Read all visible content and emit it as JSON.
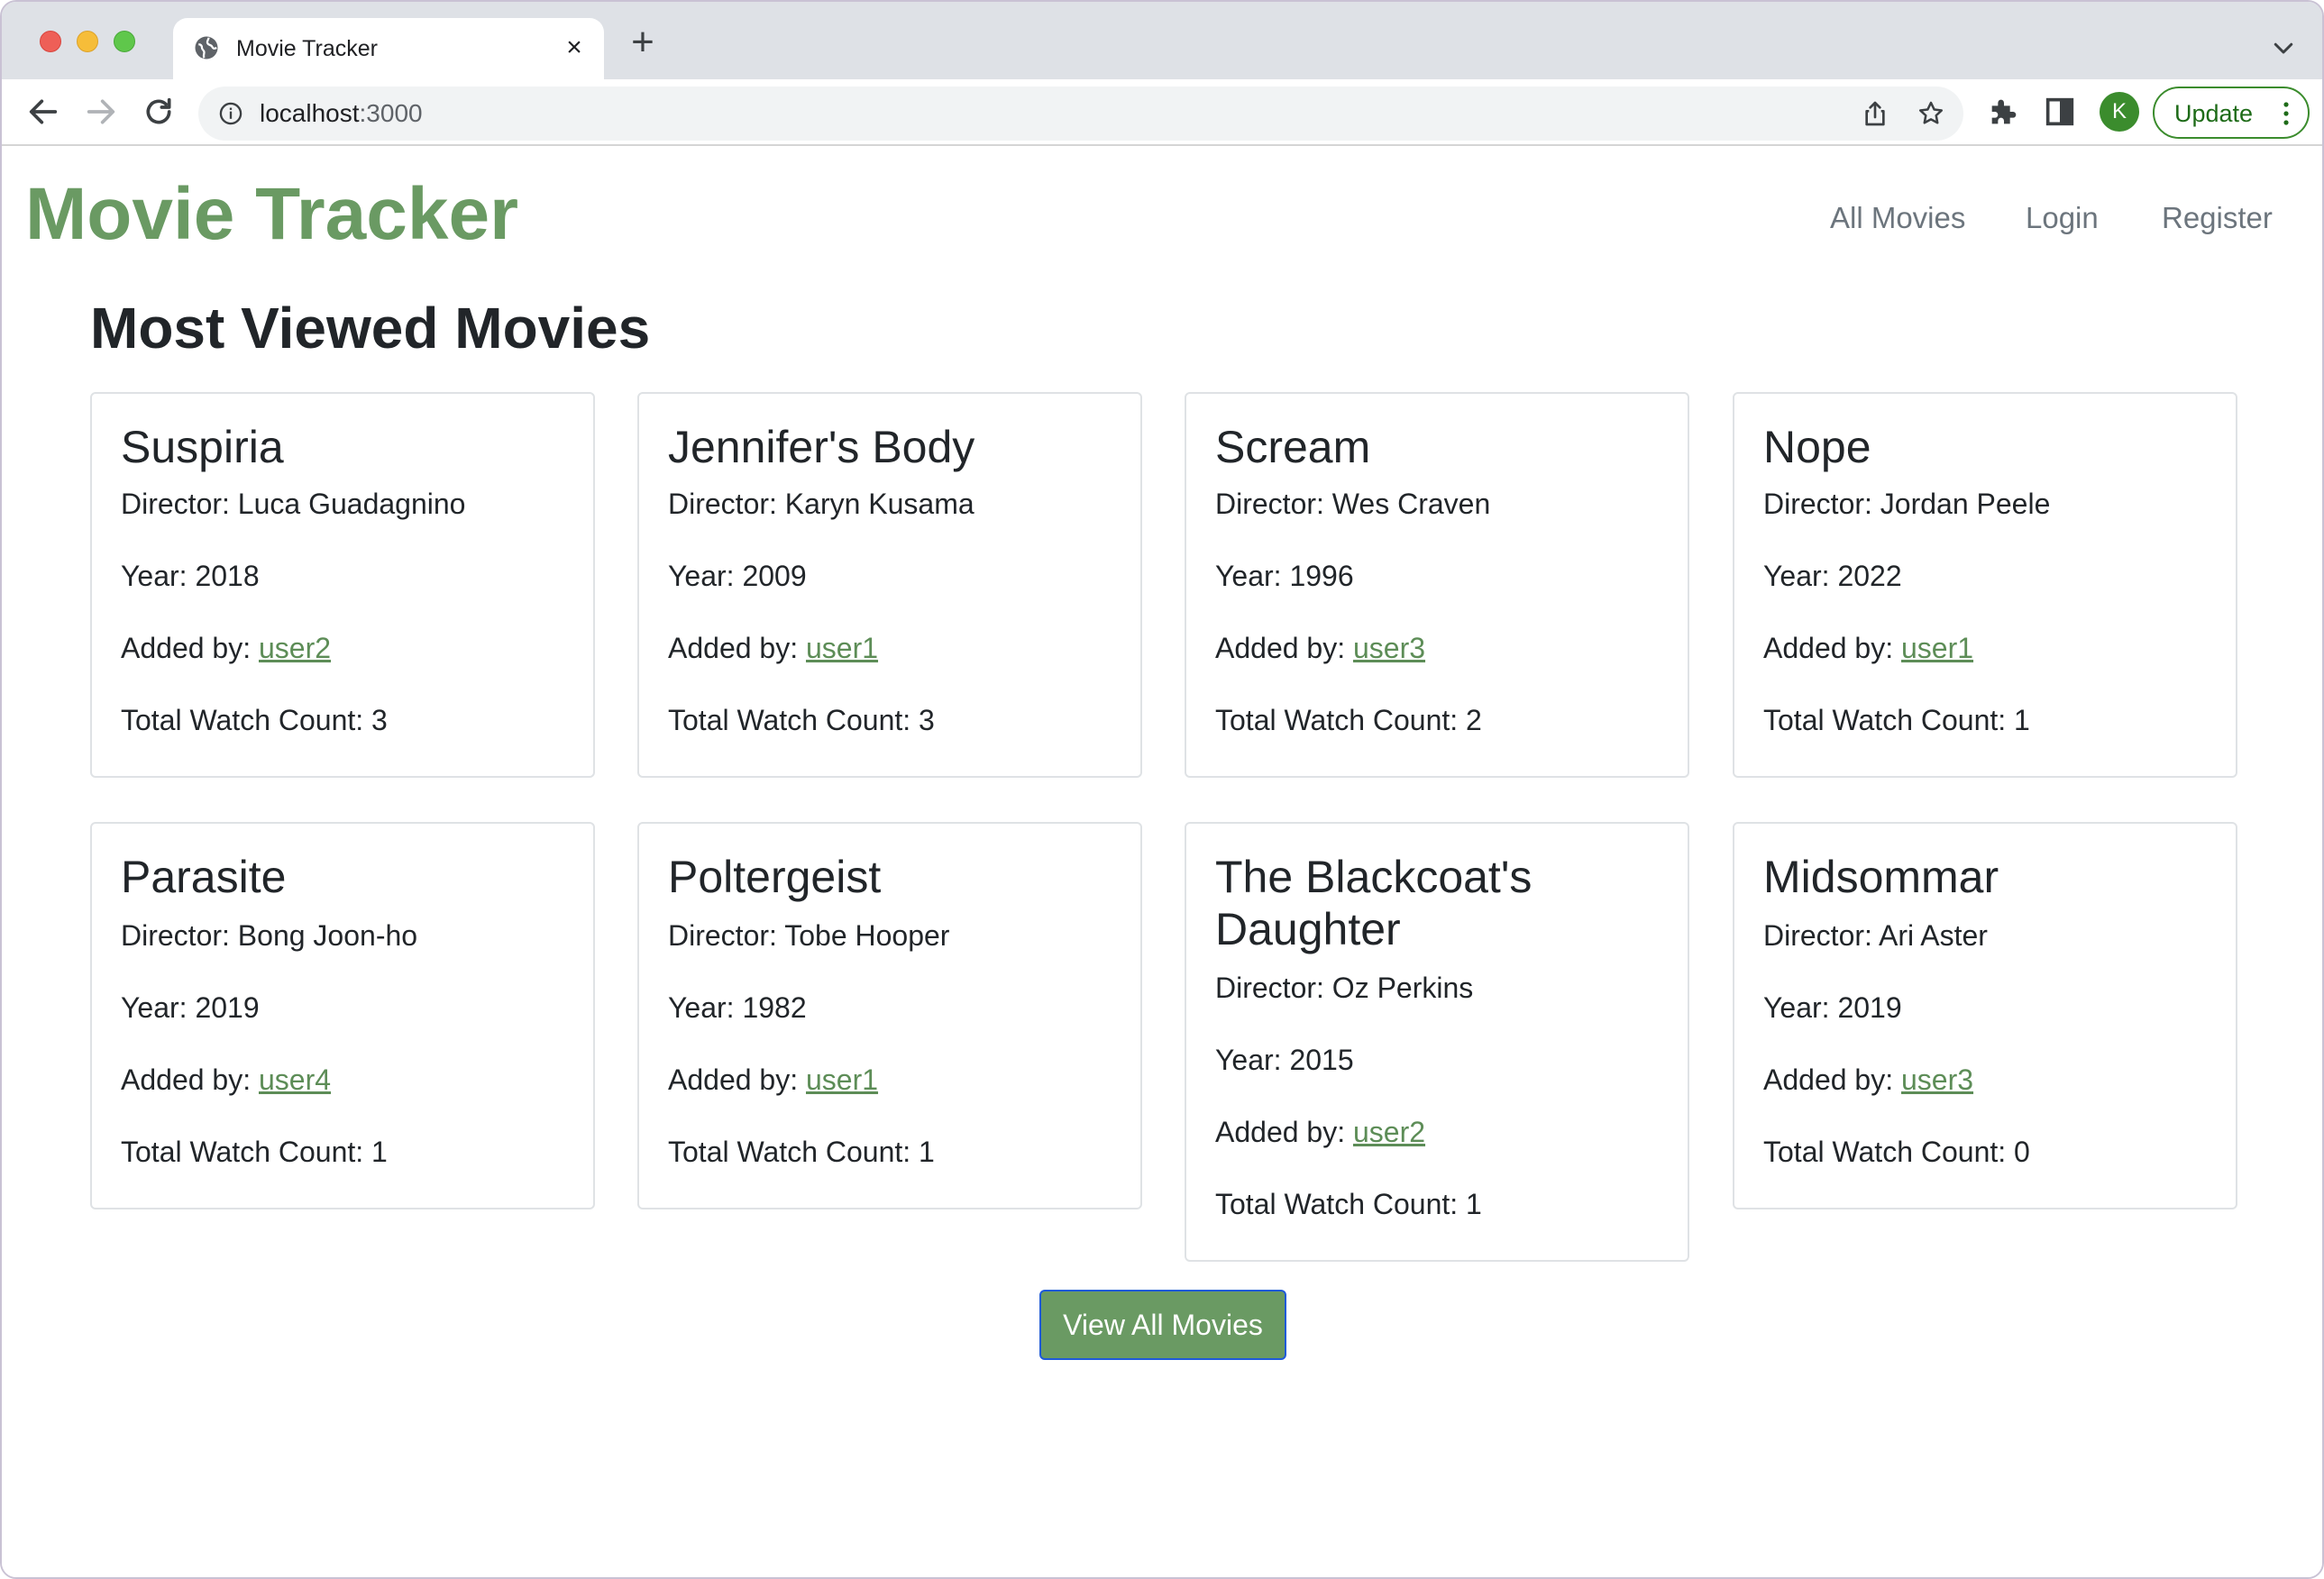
{
  "browser": {
    "tab_title": "Movie Tracker",
    "url_host": "localhost",
    "url_port": ":3000",
    "profile_initial": "K",
    "update_label": "Update"
  },
  "site": {
    "brand": "Movie Tracker",
    "nav": [
      "All Movies",
      "Login",
      "Register"
    ],
    "heading": "Most Viewed Movies",
    "view_all_label": "View All Movies"
  },
  "labels": {
    "director": "Director: ",
    "year": "Year: ",
    "added_by": "Added by: ",
    "watch_count": "Total Watch Count: "
  },
  "movies": [
    {
      "title": "Suspiria",
      "director": "Luca Guadagnino",
      "year": "2018",
      "added_by": "user2",
      "watch_count": "3"
    },
    {
      "title": "Jennifer's Body",
      "director": "Karyn Kusama",
      "year": "2009",
      "added_by": "user1",
      "watch_count": "3"
    },
    {
      "title": "Scream",
      "director": "Wes Craven",
      "year": "1996",
      "added_by": "user3",
      "watch_count": "2"
    },
    {
      "title": "Nope",
      "director": "Jordan Peele",
      "year": "2022",
      "added_by": "user1",
      "watch_count": "1"
    },
    {
      "title": "Parasite",
      "director": "Bong Joon-ho",
      "year": "2019",
      "added_by": "user4",
      "watch_count": "1"
    },
    {
      "title": "Poltergeist",
      "director": "Tobe Hooper",
      "year": "1982",
      "added_by": "user1",
      "watch_count": "1"
    },
    {
      "title": "The Blackcoat's Daughter",
      "director": "Oz Perkins",
      "year": "2015",
      "added_by": "user2",
      "watch_count": "1"
    },
    {
      "title": "Midsommar",
      "director": "Ari Aster",
      "year": "2019",
      "added_by": "user3",
      "watch_count": "0"
    }
  ],
  "colors": {
    "brand_green": "#6a9a63",
    "link_green": "#5d8d57",
    "button_border": "#1f5ad9"
  }
}
